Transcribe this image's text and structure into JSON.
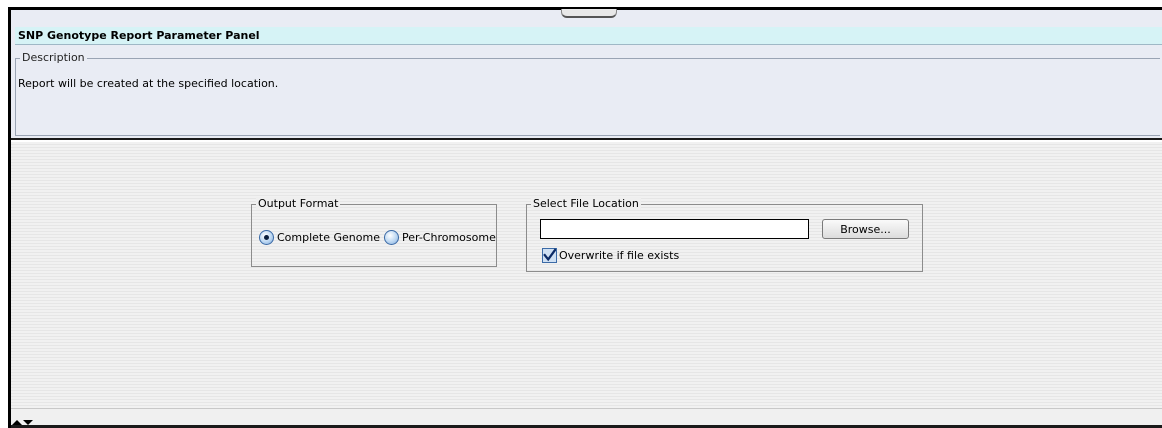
{
  "header": {
    "title": "SNP Genotype Report Parameter Panel",
    "description_legend": "Description",
    "description_text": "Report will be created at the specified location."
  },
  "output_format": {
    "legend": "Output Format",
    "options": [
      {
        "label": "Complete Genome",
        "selected": true
      },
      {
        "label": "Per-Chromosome",
        "selected": false
      }
    ]
  },
  "file_location": {
    "legend": "Select File Location",
    "path_value": "",
    "browse_label": "Browse...",
    "overwrite_label": "Overwrite if file exists",
    "overwrite_checked": true
  },
  "icons": {
    "split_handle": "splitter-handle-icon",
    "collapse": "collapse-arrows-icon",
    "check": "checkmark-icon"
  },
  "colors": {
    "title_strip": "#d6f3f6",
    "header_bg": "#e9ecf4",
    "radio_accent": "#3b6aa6",
    "check_mark": "#0b2a66"
  }
}
